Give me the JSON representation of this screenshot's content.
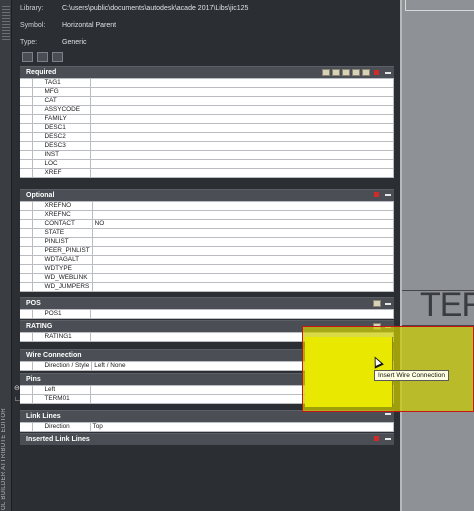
{
  "info": {
    "library_label": "Library:",
    "library_value": "C:\\users\\public\\documents\\autodesk\\acade 2017\\Libs\\jic125",
    "symbol_label": "Symbol:",
    "symbol_value": "Horizontal Parent",
    "type_label": "Type:",
    "type_value": "Generic"
  },
  "side_panel": {
    "title": "OL BUILDER ATTRIBUTE EDITOR"
  },
  "sections": {
    "required": {
      "title": "Required",
      "rows": [
        {
          "key": "TAG1",
          "value": ""
        },
        {
          "key": "MFG",
          "value": ""
        },
        {
          "key": "CAT",
          "value": ""
        },
        {
          "key": "ASSYCODE",
          "value": ""
        },
        {
          "key": "FAMILY",
          "value": ""
        },
        {
          "key": "DESC1",
          "value": ""
        },
        {
          "key": "DESC2",
          "value": ""
        },
        {
          "key": "DESC3",
          "value": ""
        },
        {
          "key": "INST",
          "value": ""
        },
        {
          "key": "LOC",
          "value": ""
        },
        {
          "key": "XREF",
          "value": ""
        }
      ]
    },
    "optional": {
      "title": "Optional",
      "rows": [
        {
          "key": "XREFNO",
          "value": ""
        },
        {
          "key": "XREFNC",
          "value": ""
        },
        {
          "key": "CONTACT",
          "value": "NO"
        },
        {
          "key": "STATE",
          "value": ""
        },
        {
          "key": "PINLIST",
          "value": ""
        },
        {
          "key": "PEER_PINLIST",
          "value": ""
        },
        {
          "key": "WDTAGALT",
          "value": ""
        },
        {
          "key": "WDTYPE",
          "value": ""
        },
        {
          "key": "WD_WEBLINK",
          "value": ""
        },
        {
          "key": "WD_JUMPERS",
          "value": ""
        }
      ]
    },
    "pos": {
      "title": "POS",
      "rows": [
        {
          "key": "POS1",
          "value": ""
        }
      ]
    },
    "rating": {
      "title": "RATING",
      "rows": [
        {
          "key": "RATING1",
          "value": ""
        }
      ]
    },
    "wire_connection": {
      "title": "Wire Connection",
      "rows": [
        {
          "key": "Direction / Style",
          "value": "Left / None"
        }
      ]
    },
    "pins": {
      "title": "Pins",
      "rows": [
        {
          "key": "Left",
          "value": ""
        },
        {
          "key": "TERM01",
          "value": ""
        }
      ]
    },
    "link_lines": {
      "title": "Link Lines",
      "rows": [
        {
          "key": "Direction",
          "value": "Top"
        }
      ]
    },
    "inserted_link_lines": {
      "title": "Inserted Link Lines"
    }
  },
  "tooltip": {
    "text": "Insert Wire Connection"
  },
  "canvas": {
    "text": "TER"
  },
  "colors": {
    "highlight": "#cccc00",
    "border_red": "#c81414",
    "header_bg": "#4b4f55"
  }
}
